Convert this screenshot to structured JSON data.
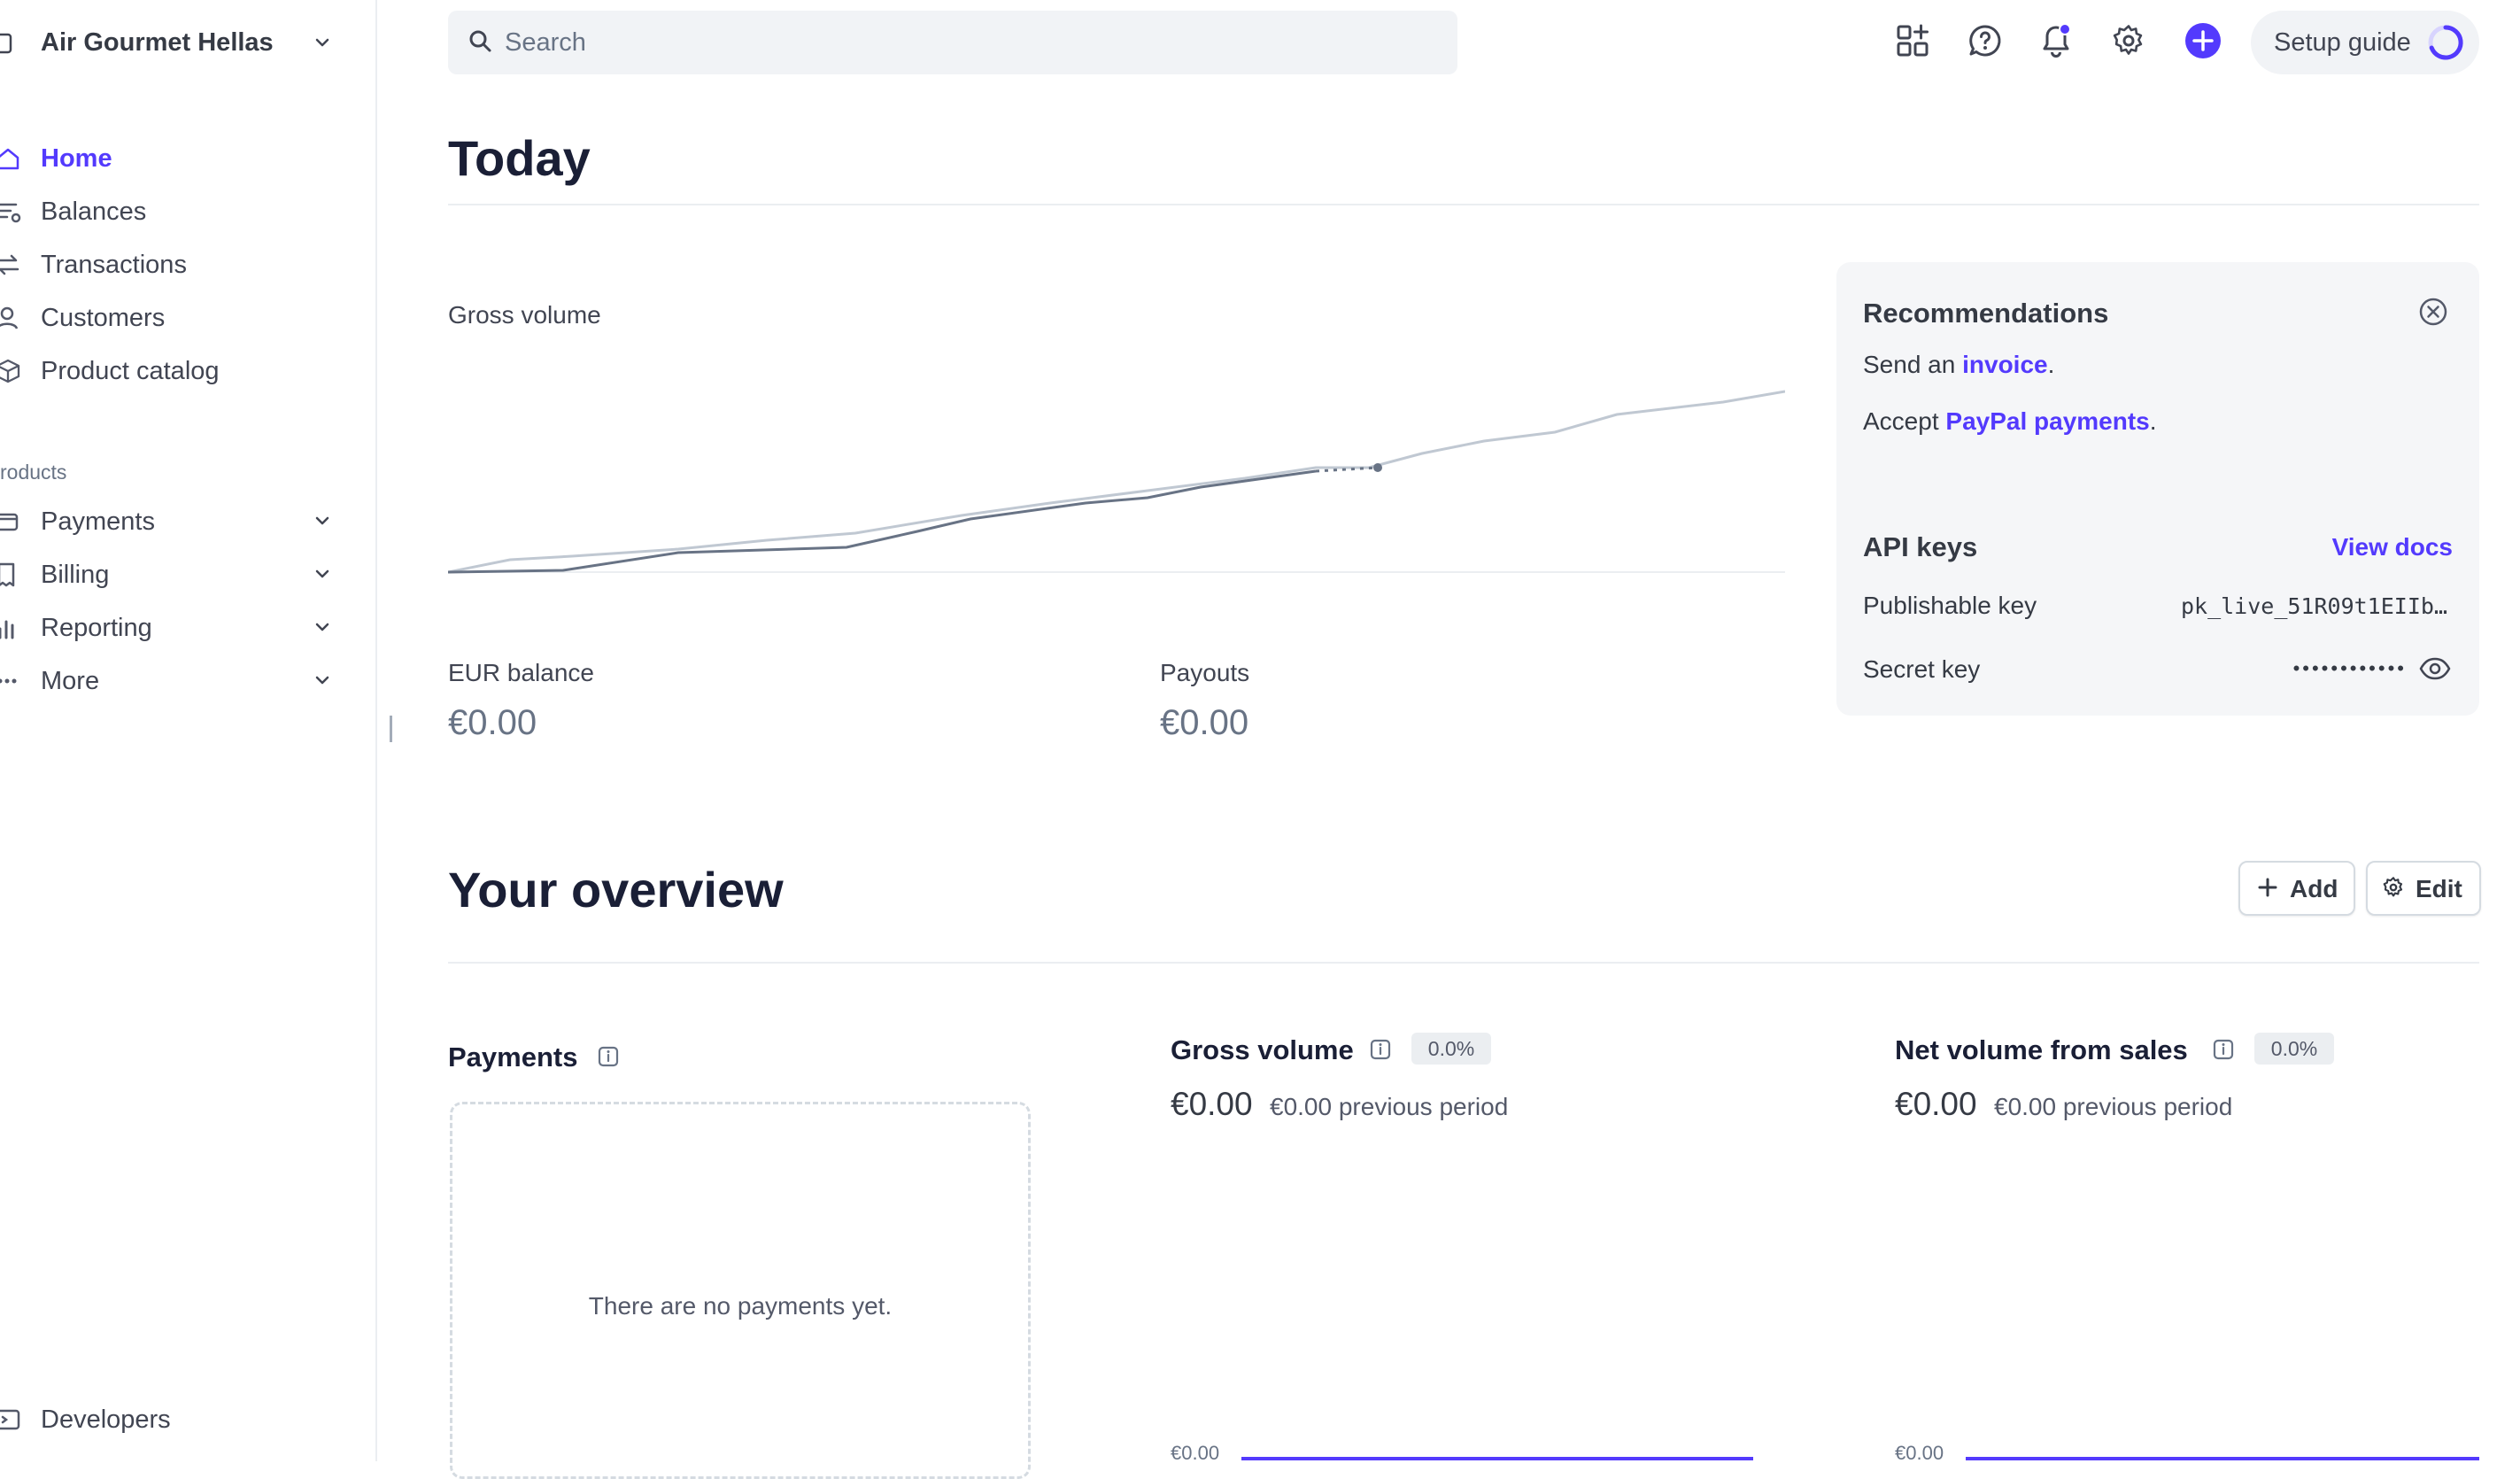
{
  "account": {
    "name": "Air Gourmet Hellas"
  },
  "nav": {
    "items": [
      {
        "label": "Home",
        "icon": "home-icon",
        "active": true
      },
      {
        "label": "Balances",
        "icon": "balances-icon"
      },
      {
        "label": "Transactions",
        "icon": "transactions-icon"
      },
      {
        "label": "Customers",
        "icon": "customers-icon"
      },
      {
        "label": "Product catalog",
        "icon": "product-catalog-icon"
      }
    ],
    "section_label": "roducts",
    "product_items": [
      {
        "label": "Payments",
        "icon": "payments-icon"
      },
      {
        "label": "Billing",
        "icon": "billing-icon"
      },
      {
        "label": "Reporting",
        "icon": "reporting-icon"
      },
      {
        "label": "More",
        "icon": "more-icon"
      }
    ],
    "developers_label": "Developers"
  },
  "topbar": {
    "search_placeholder": "Search",
    "setup_guide_label": "Setup guide",
    "accent": "#533afd"
  },
  "today": {
    "title": "Today",
    "gross_volume_label": "Gross volume",
    "eur_balance_label": "EUR balance",
    "eur_balance_value": "€0.00",
    "payouts_label": "Payouts",
    "payouts_value": "€0.00"
  },
  "recommendations": {
    "title": "Recommendations",
    "line1_prefix": "Send an ",
    "line1_link": "invoice",
    "line1_suffix": ".",
    "line2_prefix": "Accept ",
    "line2_link": "PayPal payments",
    "line2_suffix": "."
  },
  "api_keys": {
    "title": "API keys",
    "view_docs": "View docs",
    "publishable_label": "Publishable key",
    "publishable_value": "pk_live_51R09t1EIIb…",
    "secret_label": "Secret key",
    "secret_value": "••••••••••••"
  },
  "overview": {
    "title": "Your overview",
    "add_label": "Add",
    "edit_label": "Edit",
    "payments": {
      "title": "Payments",
      "empty_text": "There are no payments yet."
    },
    "gross_volume": {
      "title": "Gross volume",
      "badge": "0.0%",
      "value": "€0.00",
      "previous": "€0.00 previous period",
      "axis_label": "€0.00"
    },
    "net_volume": {
      "title": "Net volume from sales",
      "badge": "0.0%",
      "value": "€0.00",
      "previous": "€0.00 previous period",
      "axis_label": "€0.00"
    }
  }
}
